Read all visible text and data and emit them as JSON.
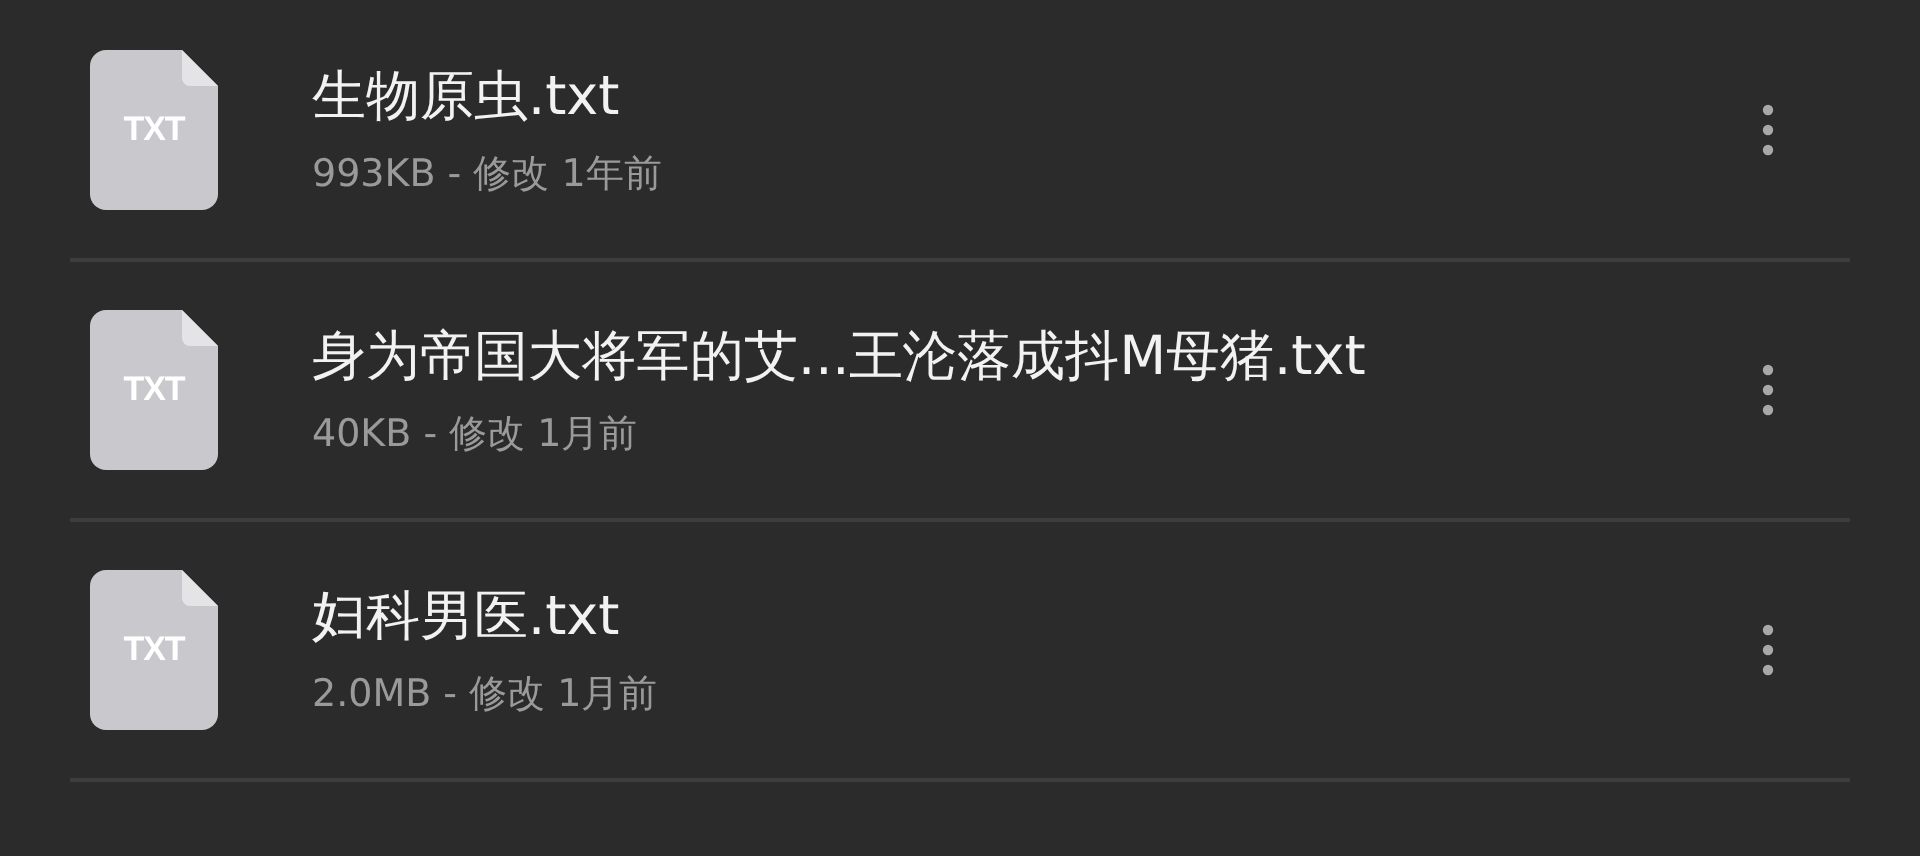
{
  "files": [
    {
      "icon_label": "TXT",
      "name": "生物原虫.txt",
      "meta": "993KB - 修改 1年前"
    },
    {
      "icon_label": "TXT",
      "name": "身为帝国大将军的艾...王沦落成抖M母猪.txt",
      "meta": "40KB - 修改 1月前"
    },
    {
      "icon_label": "TXT",
      "name": "妇科男医.txt",
      "meta": "2.0MB - 修改 1月前"
    }
  ]
}
